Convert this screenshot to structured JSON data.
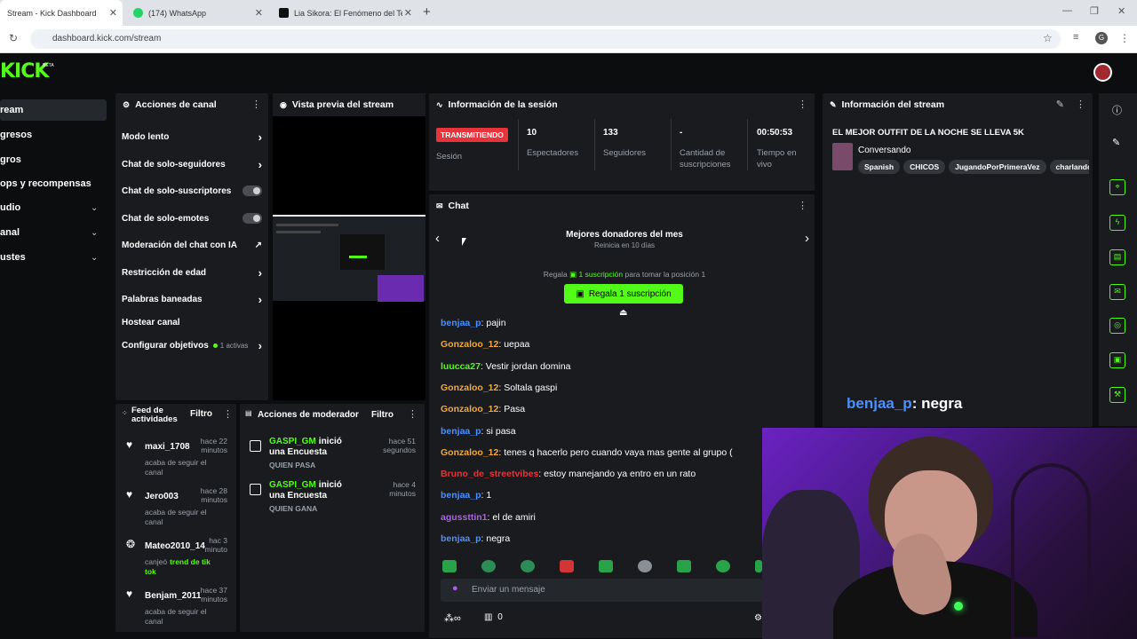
{
  "browser": {
    "tabs": [
      {
        "title": "Stream - Kick Dashboard"
      },
      {
        "title": "(174) WhatsApp"
      },
      {
        "title": "Lia Sikora: El Fenómeno del Ter"
      }
    ],
    "new_tab": "+",
    "url": "dashboard.kick.com/stream",
    "profile_initial": "G"
  },
  "app": {
    "logo": "KICK",
    "logo_badge": "BETA",
    "sidebar": [
      "ream",
      "gresos",
      "gros",
      "ops y recompensas",
      "udio",
      "anal",
      "ustes"
    ]
  },
  "channel_actions": {
    "title": "Acciones de canal",
    "items": [
      {
        "label": "Modo lento"
      },
      {
        "label": "Chat de solo-seguidores"
      },
      {
        "label": "Chat de solo-suscriptores"
      },
      {
        "label": "Chat de solo-emotes"
      },
      {
        "label": "Moderación del chat con IA"
      },
      {
        "label": "Restricción de edad"
      },
      {
        "label": "Palabras baneadas"
      },
      {
        "label": "Hostear canal"
      },
      {
        "label": "Configurar objetivos"
      }
    ],
    "goals_active": "1 activas"
  },
  "preview": {
    "title": "Vista previa del stream"
  },
  "session": {
    "title": "Información de la sesión",
    "status_badge": "TRANSMITIENDO",
    "session_label": "Sesión",
    "stats": [
      {
        "value": "10",
        "label": "Espectadores"
      },
      {
        "value": "133",
        "label": "Seguidores"
      },
      {
        "value": "-",
        "label": "Cantidad de suscripciones"
      },
      {
        "value": "00:50:53",
        "label": "Tiempo en vivo"
      }
    ]
  },
  "stream_info": {
    "title": "Información del stream",
    "stream_title": "EL MEJOR OUTFIT DE LA NOCHE SE LLEVA 5K",
    "category": "Conversando",
    "tags": [
      "Spanish",
      "CHICOS",
      "JugandoPorPrimeraVez",
      "charlando"
    ]
  },
  "chat": {
    "title": "Chat",
    "donors_title": "Mejores donadores del mes",
    "donors_sub": "Reinicia en 10 días",
    "gift_prefix": "Regala",
    "gift_link": "1 suscripción",
    "gift_suffix": "para tomar la posición 1",
    "gift_button": "Regala 1 suscripción",
    "messages": [
      {
        "user": "benjaa_p",
        "text": ": pajin",
        "color": "#4a90ff"
      },
      {
        "user": "Gonzaloo_12",
        "text": ": uepaa",
        "color": "#f2a93b"
      },
      {
        "user": "luucca27",
        "text": ": Vestir jordan domina",
        "color": "#53fc18"
      },
      {
        "user": "Gonzaloo_12",
        "text": ": Soltala gaspi",
        "color": "#f2a93b"
      },
      {
        "user": "Gonzaloo_12",
        "text": ": Pasa",
        "color": "#f2a93b"
      },
      {
        "user": "benjaa_p",
        "text": ": si pasa",
        "color": "#4a90ff"
      },
      {
        "user": "Gonzaloo_12",
        "text": ": tenes q hacerlo pero cuando vaya mas gente al grupo (",
        "color": "#f2a93b"
      },
      {
        "user": "Bruno_de_streetvibes",
        "text": ": estoy manejando ya entro en un rato",
        "color": "#e8333a"
      },
      {
        "user": "benjaa_p",
        "text": ": 1",
        "color": "#4a90ff"
      },
      {
        "user": "agussttin1",
        "text": ": el de amiri",
        "color": "#b15cf0"
      },
      {
        "user": "benjaa_p",
        "text": ": negra",
        "color": "#4a90ff"
      }
    ],
    "input_placeholder": "Enviar un mensaje",
    "bits": "0"
  },
  "activity": {
    "title": "Feed de actividades",
    "filter": "Filtro",
    "items": [
      {
        "name": "maxi_1708",
        "time": "hace 22 minutos",
        "sub": "acaba de seguir el canal"
      },
      {
        "name": "Jero003",
        "time": "hace 28 minutos",
        "sub": "acaba de seguir el canal"
      },
      {
        "name": "Mateo2010_14",
        "time": "hac 3 minuto",
        "sub": "canjeó",
        "reward": "trend de tik tok"
      },
      {
        "name": "Benjam_2011",
        "time": "hace 37 minutos",
        "sub": "acaba de seguir el canal"
      }
    ]
  },
  "mod_actions": {
    "title": "Acciones de moderador",
    "filter": "Filtro",
    "items": [
      {
        "user": "GASPI_GM",
        "action": "inició una Encuesta",
        "sub": "QUIEN PASA",
        "time": "hace 51 segundos"
      },
      {
        "user": "GASPI_GM",
        "action": "inició una Encuesta",
        "sub": "QUIEN GANA",
        "time": "hace 4 minutos"
      }
    ]
  },
  "overlay": {
    "user": "benjaa_p",
    "text": ": negra"
  },
  "colors": {
    "accent": "#53fc18",
    "live": "#e8333a",
    "panel": "#191b1f",
    "bg": "#0b0d0f"
  }
}
